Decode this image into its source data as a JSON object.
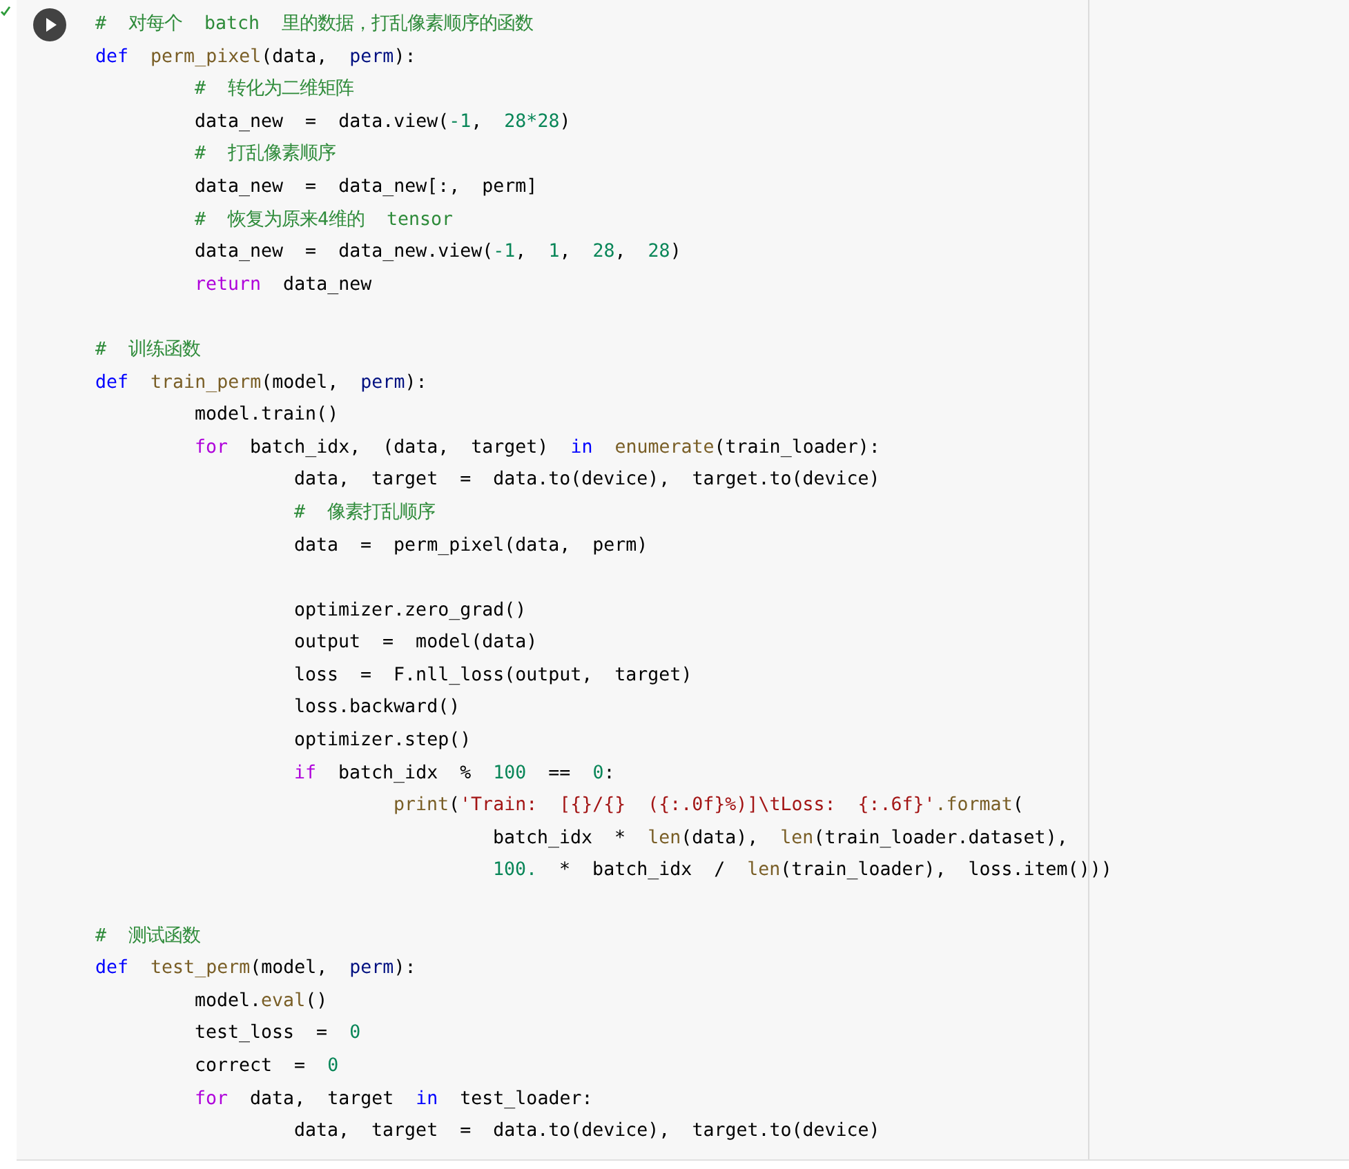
{
  "cell": {
    "executed": true,
    "lines": [
      {
        "tokens": [
          {
            "kind": "c",
            "text": "#  对每个  batch  里的数据，打乱像素顺序的函数"
          }
        ]
      },
      {
        "tokens": [
          {
            "kind": "kw",
            "text": "def"
          },
          {
            "kind": "fn",
            "text": "  perm_pixel"
          },
          {
            "kind": "t",
            "text": "(data,  "
          },
          {
            "kind": "p",
            "text": "perm"
          },
          {
            "kind": "t",
            "text": "):"
          }
        ],
        "children": [
          {
            "tokens": [
              {
                "kind": "c",
                "text": "#  转化为二维矩阵"
              }
            ]
          },
          {
            "tokens": [
              {
                "kind": "t",
                "text": "data_new  =  data.view("
              },
              {
                "kind": "n",
                "text": "-1"
              },
              {
                "kind": "t",
                "text": ",  "
              },
              {
                "kind": "n",
                "text": "28*28"
              },
              {
                "kind": "t",
                "text": ")"
              }
            ]
          },
          {
            "tokens": [
              {
                "kind": "c",
                "text": "#  打乱像素顺序"
              }
            ]
          },
          {
            "tokens": [
              {
                "kind": "t",
                "text": "data_new  =  data_new[:,  perm]"
              }
            ]
          },
          {
            "tokens": [
              {
                "kind": "c",
                "text": "#  恢复为原来4维的  tensor"
              }
            ]
          },
          {
            "tokens": [
              {
                "kind": "t",
                "text": "data_new  =  data_new.view("
              },
              {
                "kind": "n",
                "text": "-1"
              },
              {
                "kind": "t",
                "text": ",  "
              },
              {
                "kind": "n",
                "text": "1"
              },
              {
                "kind": "t",
                "text": ",  "
              },
              {
                "kind": "n",
                "text": "28"
              },
              {
                "kind": "t",
                "text": ",  "
              },
              {
                "kind": "n",
                "text": "28"
              },
              {
                "kind": "t",
                "text": ")"
              }
            ]
          },
          {
            "tokens": [
              {
                "kind": "ctl",
                "text": "return"
              },
              {
                "kind": "t",
                "text": "  data_new"
              }
            ]
          }
        ]
      },
      {
        "gap_before": true,
        "tokens": [
          {
            "kind": "c",
            "text": "#  训练函数"
          }
        ]
      },
      {
        "tokens": [
          {
            "kind": "kw",
            "text": "def"
          },
          {
            "kind": "fn",
            "text": "  train_perm"
          },
          {
            "kind": "t",
            "text": "(model,  "
          },
          {
            "kind": "p",
            "text": "perm"
          },
          {
            "kind": "t",
            "text": "):"
          }
        ],
        "children": [
          {
            "tokens": [
              {
                "kind": "t",
                "text": "model.train()"
              }
            ]
          },
          {
            "tokens": [
              {
                "kind": "ctl",
                "text": "for"
              },
              {
                "kind": "t",
                "text": "  batch_idx,  (data,  target)  "
              },
              {
                "kind": "kw",
                "text": "in"
              },
              {
                "kind": "fn",
                "text": "  enumerate"
              },
              {
                "kind": "t",
                "text": "(train_loader):"
              }
            ],
            "children": [
              {
                "tokens": [
                  {
                    "kind": "t",
                    "text": "data,  target  =  data.to(device),  target.to(device)"
                  }
                ]
              },
              {
                "tokens": [
                  {
                    "kind": "c",
                    "text": "#  像素打乱顺序"
                  }
                ]
              },
              {
                "tokens": [
                  {
                    "kind": "t",
                    "text": "data  =  perm_pixel(data,  perm)"
                  }
                ]
              },
              {
                "gap_before": true,
                "tokens": [
                  {
                    "kind": "t",
                    "text": "optimizer.zero_grad()"
                  }
                ]
              },
              {
                "tokens": [
                  {
                    "kind": "t",
                    "text": "output  =  model(data)"
                  }
                ]
              },
              {
                "tokens": [
                  {
                    "kind": "t",
                    "text": "loss  =  F.nll_loss(output,  target)"
                  }
                ]
              },
              {
                "tokens": [
                  {
                    "kind": "t",
                    "text": "loss.backward()"
                  }
                ]
              },
              {
                "tokens": [
                  {
                    "kind": "t",
                    "text": "optimizer.step()"
                  }
                ]
              },
              {
                "tokens": [
                  {
                    "kind": "ctl",
                    "text": "if"
                  },
                  {
                    "kind": "t",
                    "text": "  batch_idx  %  "
                  },
                  {
                    "kind": "n",
                    "text": "100"
                  },
                  {
                    "kind": "t",
                    "text": "  ==  "
                  },
                  {
                    "kind": "n",
                    "text": "0"
                  },
                  {
                    "kind": "t",
                    "text": ":"
                  }
                ],
                "children": [
                  {
                    "tokens": [
                      {
                        "kind": "fn",
                        "text": "print"
                      },
                      {
                        "kind": "t",
                        "text": "("
                      },
                      {
                        "kind": "s",
                        "text": "'Train:  [{}/{}  ({:.0f}%)]\\tLoss:  {:.6f}'"
                      },
                      {
                        "kind": "fn",
                        "text": ".format"
                      },
                      {
                        "kind": "t",
                        "text": "("
                      }
                    ],
                    "children": [
                      {
                        "tokens": [
                          {
                            "kind": "t",
                            "text": "batch_idx  *  "
                          },
                          {
                            "kind": "fn",
                            "text": "len"
                          },
                          {
                            "kind": "t",
                            "text": "(data),  "
                          },
                          {
                            "kind": "fn",
                            "text": "len"
                          },
                          {
                            "kind": "t",
                            "text": "(train_loader.dataset),"
                          }
                        ]
                      },
                      {
                        "tokens": [
                          {
                            "kind": "n",
                            "text": "100."
                          },
                          {
                            "kind": "t",
                            "text": "  *  batch_idx  /  "
                          },
                          {
                            "kind": "fn",
                            "text": "len"
                          },
                          {
                            "kind": "t",
                            "text": "(train_loader),  loss.item()))"
                          }
                        ]
                      }
                    ]
                  }
                ]
              }
            ]
          }
        ]
      },
      {
        "gap_before": true,
        "tokens": [
          {
            "kind": "c",
            "text": "#  测试函数"
          }
        ]
      },
      {
        "tokens": [
          {
            "kind": "kw",
            "text": "def"
          },
          {
            "kind": "fn",
            "text": "  test_perm"
          },
          {
            "kind": "t",
            "text": "(model,  "
          },
          {
            "kind": "p",
            "text": "perm"
          },
          {
            "kind": "t",
            "text": "):"
          }
        ],
        "children": [
          {
            "tokens": [
              {
                "kind": "t",
                "text": "model."
              },
              {
                "kind": "fn",
                "text": "eval"
              },
              {
                "kind": "t",
                "text": "()"
              }
            ]
          },
          {
            "tokens": [
              {
                "kind": "t",
                "text": "test_loss  =  "
              },
              {
                "kind": "n",
                "text": "0"
              }
            ]
          },
          {
            "tokens": [
              {
                "kind": "t",
                "text": "correct  =  "
              },
              {
                "kind": "n",
                "text": "0"
              }
            ]
          },
          {
            "tokens": [
              {
                "kind": "ctl",
                "text": "for"
              },
              {
                "kind": "t",
                "text": "  data,  target  "
              },
              {
                "kind": "kw",
                "text": "in"
              },
              {
                "kind": "t",
                "text": "  test_loader:"
              }
            ],
            "children": [
              {
                "tokens": [
                  {
                    "kind": "t",
                    "text": "data,  target  =  data.to(device),  target.to(device)"
                  }
                ]
              }
            ]
          }
        ]
      }
    ]
  }
}
